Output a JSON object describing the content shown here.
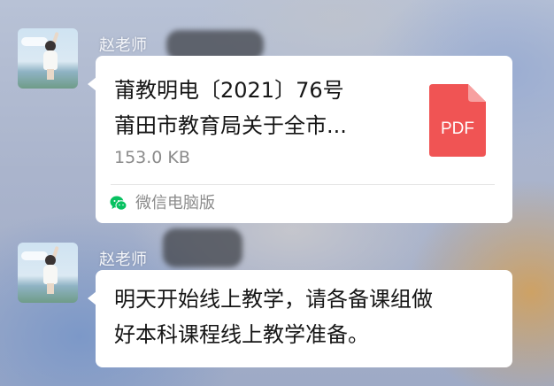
{
  "messages": [
    {
      "sender": "赵老师",
      "file": {
        "title": "莆教明电〔2021〕76号",
        "subtitle": "莆田市教育局关于全市...",
        "size": "153.0 KB",
        "type_label": "PDF",
        "source": "微信电脑版"
      }
    },
    {
      "sender": "赵老师",
      "text_line1": "明天开始线上教学，请各备课组做",
      "text_line2": "好本科课程线上教学准备。"
    }
  ],
  "colors": {
    "pdf_red": "#f05454",
    "wechat_green": "#07c160",
    "bubble": "#ffffff"
  }
}
